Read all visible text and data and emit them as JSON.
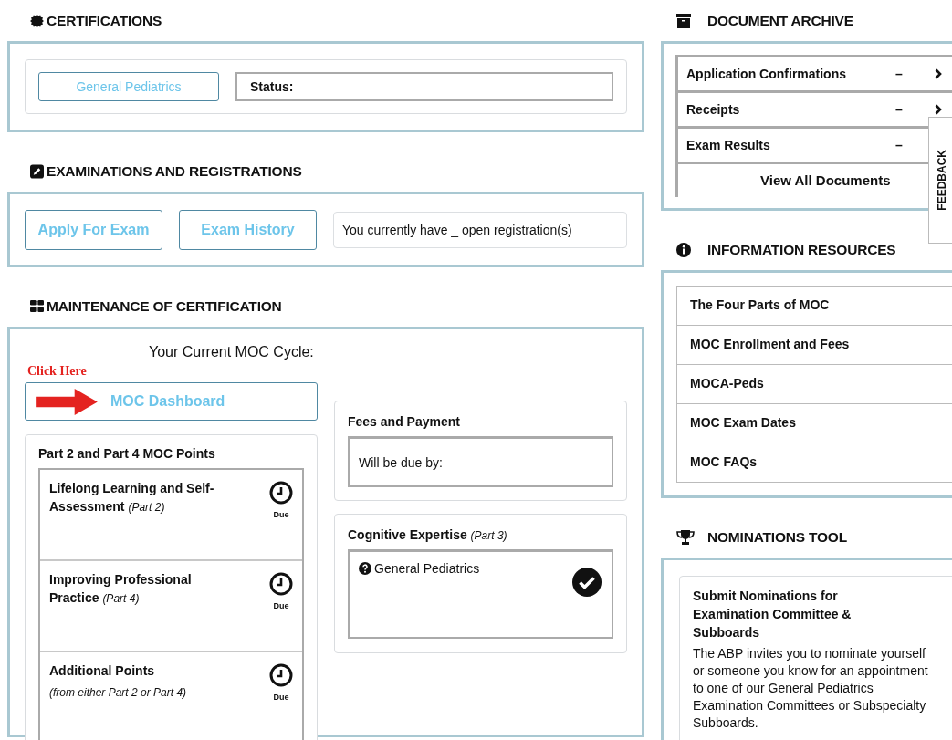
{
  "certifications": {
    "title": "CERTIFICATIONS",
    "button": "General Pediatrics",
    "status_label": "Status:"
  },
  "examinations": {
    "title": "EXAMINATIONS AND REGISTRATIONS",
    "buttons": [
      "Apply For Exam",
      "Exam History"
    ],
    "message": "You currently have _ open registration(s)"
  },
  "moc": {
    "title": "MAINTENANCE OF CERTIFICATION",
    "cycle_label": "Your Current MOC Cycle:",
    "annotation": "Click Here",
    "dashboard_button": "MOC Dashboard",
    "points": {
      "title": "Part 2 and Part 4 MOC Points",
      "items": [
        {
          "kind": "inline-note",
          "title": "Lifelong Learning and Self-Assessment",
          "note": "(Part 2)",
          "status": "Due"
        },
        {
          "kind": "inline-note",
          "title": "Improving Professional Practice",
          "note": "(Part 4)",
          "status": "Due"
        },
        {
          "kind": "block-note",
          "title": "Additional Points",
          "note": "(from either Part 2 or Part 4)",
          "status": "Due"
        }
      ]
    },
    "fees": {
      "title": "Fees and Payment",
      "due_label": "Will be due by:"
    },
    "cognitive": {
      "title": "Cognitive Expertise",
      "note": "(Part 3)",
      "item": "General Pediatrics",
      "completed": true
    }
  },
  "document_archive": {
    "title": "DOCUMENT ARCHIVE",
    "items": [
      {
        "name": "Application Confirmations",
        "value": "–"
      },
      {
        "name": "Receipts",
        "value": "–"
      },
      {
        "name": "Exam Results",
        "value": "–"
      }
    ],
    "view_all": "View All Documents"
  },
  "information_resources": {
    "title": "INFORMATION RESOURCES",
    "items": [
      "The Four Parts of MOC",
      "MOC Enrollment and Fees",
      "MOCA-Peds",
      "MOC Exam Dates",
      "MOC FAQs"
    ]
  },
  "nominations": {
    "title": "NOMINATIONS TOOL",
    "card_title": "Submit Nominations for Examination Committee & Subboards",
    "body": "The ABP invites you to nominate yourself or someone you know for an appointment to one of our General Pediatrics Examination Committees or Subspecialty Subboards."
  },
  "feedback_tab": {
    "label": "FEEDBACK"
  }
}
